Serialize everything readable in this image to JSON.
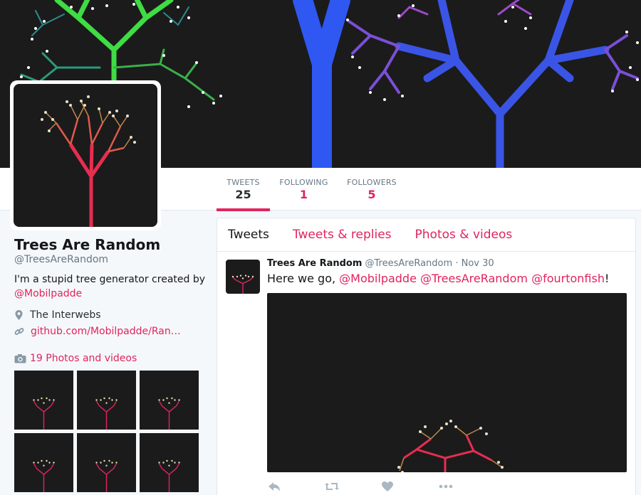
{
  "colors": {
    "accent": "#e0245e",
    "text": "#14171a",
    "muted": "#657786",
    "page_bg": "#f5f8fa",
    "image_bg": "#1b1b1c"
  },
  "nav": {
    "stats": [
      {
        "label": "TWEETS",
        "value": "25",
        "active": true
      },
      {
        "label": "FOLLOWING",
        "value": "1",
        "active": false
      },
      {
        "label": "FOLLOWERS",
        "value": "5",
        "active": false
      }
    ]
  },
  "profile": {
    "name": "Trees Are Random",
    "handle": "@TreesAreRandom",
    "bio": "I'm a stupid tree generator created by",
    "bio_mention": "@Mobilpadde",
    "location": "The Interwebs",
    "url": "github.com/Mobilpadde/Ran…",
    "photos_label": "19 Photos and videos"
  },
  "timeline": {
    "tabs": [
      {
        "label": "Tweets",
        "active": true
      },
      {
        "label": "Tweets & replies",
        "active": false
      },
      {
        "label": "Photos & videos",
        "active": false
      }
    ]
  },
  "tweet": {
    "name": "Trees Are Random",
    "handle": "@TreesAreRandom",
    "separator": "·",
    "time": "Nov 30",
    "text_start": "Here we go, ",
    "mentions": [
      "@Mobilpadde",
      "@TreesAreRandom",
      "@fourtonfish"
    ],
    "text_end": "!",
    "actions": [
      "reply-icon",
      "retweet-icon",
      "like-icon",
      "more-icon"
    ]
  },
  "icons": {
    "location": "location-pin-icon",
    "link": "link-icon",
    "photos": "camera-icon"
  }
}
